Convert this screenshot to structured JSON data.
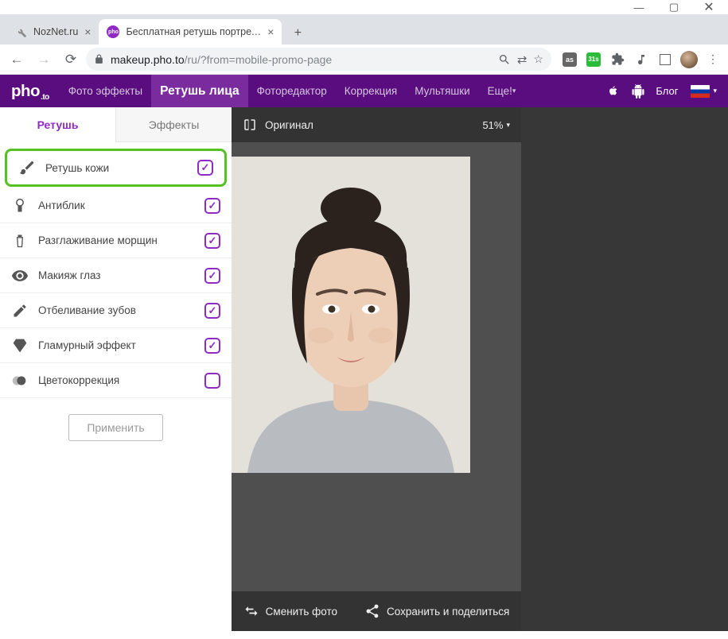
{
  "window": {
    "tabs": [
      {
        "title": "NozNet.ru",
        "active": false
      },
      {
        "title": "Бесплатная ретушь портретных",
        "active": true
      }
    ]
  },
  "browser": {
    "url_host": "makeup.pho.to",
    "url_path": "/ru/?from=mobile-promo-page"
  },
  "header": {
    "logo_main": "pho",
    "logo_sub": ".to",
    "nav": [
      "Фото эффекты",
      "Ретушь лица",
      "Фоторедактор",
      "Коррекция",
      "Мультяшки",
      "Еще!"
    ],
    "active_nav_index": 1,
    "blog": "Блог"
  },
  "sidebar": {
    "tabs": [
      "Ретушь",
      "Эффекты"
    ],
    "active_tab_index": 0,
    "options": [
      {
        "label": "Ретушь кожи",
        "checked": true,
        "highlight": true,
        "icon": "brush"
      },
      {
        "label": "Антиблик",
        "checked": true,
        "icon": "mirror"
      },
      {
        "label": "Разглаживание морщин",
        "checked": true,
        "icon": "tube"
      },
      {
        "label": "Макияж глаз",
        "checked": true,
        "icon": "eye"
      },
      {
        "label": "Отбеливание зубов",
        "checked": true,
        "icon": "pencil"
      },
      {
        "label": "Гламурный эффект",
        "checked": true,
        "icon": "diamond"
      },
      {
        "label": "Цветокоррекция",
        "checked": false,
        "icon": "contrast"
      }
    ],
    "apply_label": "Применить"
  },
  "canvas": {
    "original_label": "Оригинал",
    "zoom": "51%",
    "footer": {
      "change": "Сменить фото",
      "save": "Сохранить и поделиться"
    }
  }
}
